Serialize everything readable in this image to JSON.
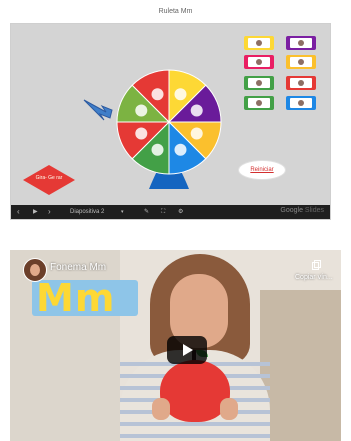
{
  "page": {
    "title": "Ruleta Mm"
  },
  "slides": {
    "spin_button_label": "Gira- Ge rar",
    "restart_label": "Reiniciar",
    "toolbar": {
      "prev_icon": "chevron-left-icon",
      "play_icon": "play-icon",
      "next_icon": "chevron-right-icon",
      "slide_label": "Diapositiva 2",
      "slide_dropdown_icon": "chevron-down-icon",
      "pen_icon": "pen-icon",
      "fullscreen_icon": "fullscreen-icon",
      "settings_icon": "gear-icon",
      "brand_google": "Google",
      "brand_slides": "Slides"
    },
    "wheel": {
      "segments": [
        {
          "color": "#fdd835",
          "icon": "bunny-icon"
        },
        {
          "color": "#6a1b9a",
          "icon": "fork-icon"
        },
        {
          "color": "#fbc02d",
          "icon": "monkey-icon"
        },
        {
          "color": "#1e88e5",
          "icon": "apple-icon"
        },
        {
          "color": "#43a047",
          "icon": "mouse-icon"
        },
        {
          "color": "#e53935",
          "icon": "bee-icon"
        },
        {
          "color": "#7cb342",
          "icon": "dog-icon"
        },
        {
          "color": "#e53935",
          "icon": "clock-icon"
        }
      ],
      "base_color": "#1565c0",
      "pointer_color": "#3f7ec9"
    },
    "cards": [
      {
        "border": "#fdd835",
        "icon": "bunny-icon"
      },
      {
        "border": "#7b1fa2",
        "icon": "fork-icon"
      },
      {
        "border": "#e91e63",
        "icon": "monkey-icon"
      },
      {
        "border": "#fbc02d",
        "icon": "apple-icon"
      },
      {
        "border": "#43a047",
        "icon": "mouse-icon"
      },
      {
        "border": "#e53935",
        "icon": "bee-icon"
      },
      {
        "border": "#43a047",
        "icon": "dog-icon"
      },
      {
        "border": "#1e88e5",
        "icon": "clock-icon"
      }
    ]
  },
  "video": {
    "title": "Fonema Mm",
    "copy_label": "Copiar vín...",
    "logo_text": "Mm",
    "play_icon": "play-icon"
  }
}
